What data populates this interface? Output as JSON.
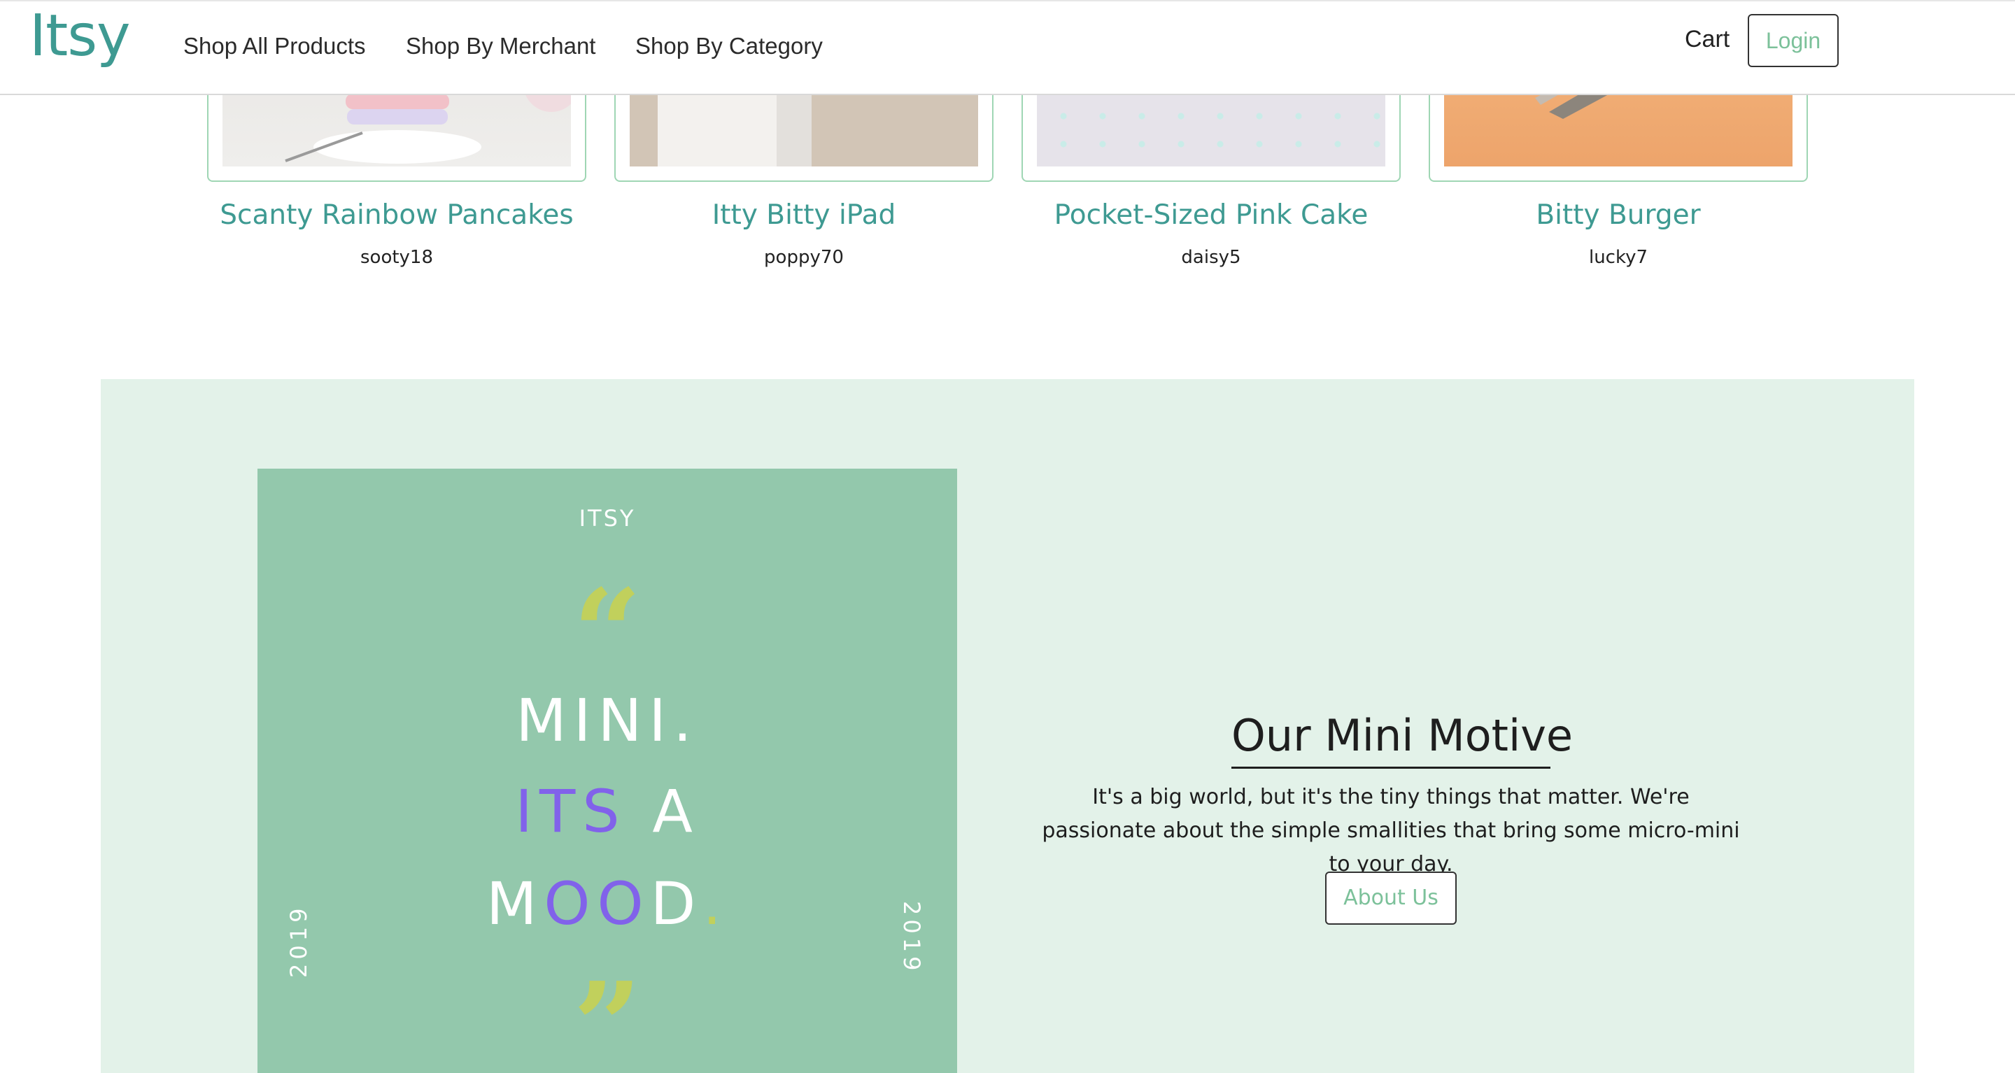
{
  "navbar": {
    "brand": "Itsy",
    "links": [
      "Shop All Products",
      "Shop By Merchant",
      "Shop By Category"
    ],
    "cart_label": "Cart",
    "login_label": "Login"
  },
  "products": [
    {
      "title": "Scanty Rainbow Pancakes",
      "merchant": "sooty18"
    },
    {
      "title": "Itty Bitty iPad",
      "merchant": "poppy70"
    },
    {
      "title": "Pocket-Sized Pink Cake",
      "merchant": "daisy5"
    },
    {
      "title": "Bitty Burger",
      "merchant": "lucky7"
    }
  ],
  "poster": {
    "brand": "ITSY",
    "open_quote": "“",
    "close_quote": "”",
    "line1": "MINI.",
    "line2_a": "ITS",
    "line2_b": "A",
    "line3_a": "M",
    "line3_b": "OO",
    "line3_c": "D",
    "line3_dot": ".",
    "year": "2019"
  },
  "motive": {
    "title": "Our Mini Motive",
    "text": "It's a big world, but it's the tiny things that matter. We're passionate about the simple smallities that bring some micro-mini to your day.",
    "button_label": "About Us"
  },
  "colors": {
    "brand_teal": "#3e9a92",
    "login_green": "#7cc19a",
    "section_bg": "#e3f2e9",
    "poster_bg": "#93c8ac",
    "poster_purple": "#8162ea",
    "poster_yellow": "#c1d05c"
  }
}
